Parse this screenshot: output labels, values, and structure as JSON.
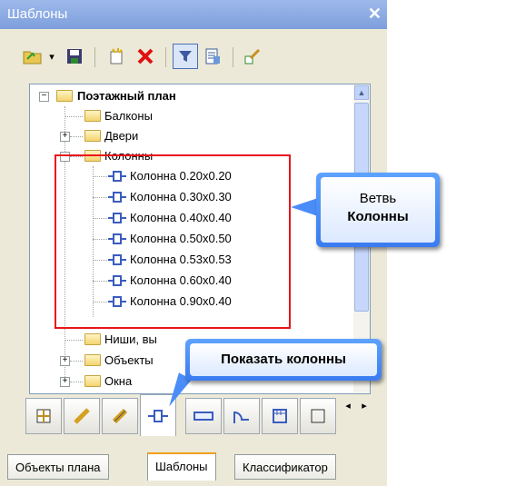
{
  "window": {
    "title": "Шаблоны",
    "close_label": "✕"
  },
  "toolbar": {
    "buttons": [
      {
        "name": "open-folder-icon",
        "glyph": "📂"
      },
      {
        "name": "dropdown-arrow-icon",
        "glyph": "▾"
      },
      {
        "name": "save-icon",
        "glyph": "💾"
      },
      {
        "name": "new-item-icon",
        "glyph": "✱"
      },
      {
        "name": "delete-icon",
        "glyph": "✕"
      },
      {
        "name": "filter-icon",
        "glyph": "▼"
      },
      {
        "name": "properties-icon",
        "glyph": "▤"
      },
      {
        "name": "edit-template-icon",
        "glyph": "✎"
      }
    ]
  },
  "tree": {
    "root": "Поэтажный план",
    "items": [
      {
        "label": "Балконы",
        "expandable": false
      },
      {
        "label": "Двери",
        "expandable": true,
        "expander": "+"
      },
      {
        "label": "Колонны",
        "expandable": true,
        "expander": "−"
      },
      {
        "label": "Ниши, вы",
        "expandable": false
      },
      {
        "label": "Объекты",
        "expandable": true,
        "expander": "+"
      },
      {
        "label": "Окна",
        "expandable": true,
        "expander": "+"
      }
    ],
    "columns": [
      "Колонна 0.20x0.20",
      "Колонна 0.30x0.30",
      "Колонна 0.40x0.40",
      "Колонна 0.50x0.50",
      "Колонна 0.53x0.53",
      "Колонна 0.60x0.40",
      "Колонна 0.90x0.40"
    ],
    "root_expander": "−"
  },
  "callouts": {
    "branch_line1": "Ветвь",
    "branch_line2": "Колонны",
    "show_columns": "Показать колонны"
  },
  "icon_tabs": {
    "items": [
      "floor-plan-icon",
      "wall-icon",
      "beam-icon",
      "column-icon",
      "window-icon",
      "door-icon",
      "stair-icon",
      "more-icon"
    ],
    "active_index": 3,
    "nav_left": "◂",
    "nav_right": "▸"
  },
  "bottom_tabs": {
    "items": [
      "Объекты плана",
      "Шаблоны",
      "Классификатор"
    ],
    "active": "Шаблоны"
  },
  "colors": {
    "highlight": "#e8141b",
    "callout": "#4b8df8",
    "title_bar": "#8aa8e2"
  }
}
